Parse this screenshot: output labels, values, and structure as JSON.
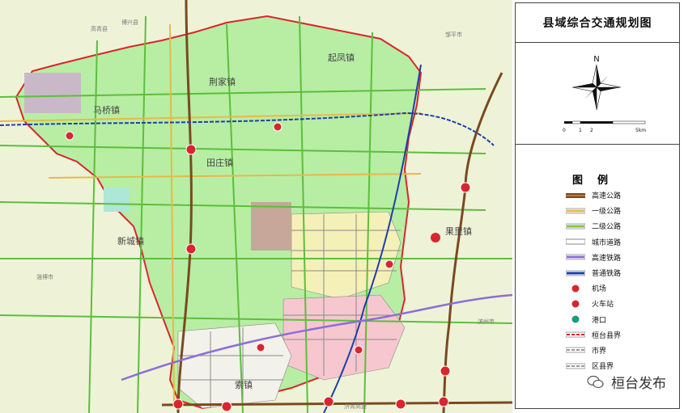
{
  "map": {
    "towns": [
      "马桥镇",
      "荆家镇",
      "起凤镇",
      "田庄镇",
      "新城镇",
      "索镇",
      "果里镇"
    ],
    "neighbors": [
      "高青县",
      "邹平市",
      "淄博市",
      "滨州市",
      "博兴县"
    ],
    "bottom_road": "济青高速"
  },
  "panel": {
    "title": "县域综合交通规划图",
    "north": "N",
    "scale": {
      "ticks": [
        "0",
        "1",
        "2",
        "5km"
      ]
    },
    "legend_title": "图例",
    "legend": [
      {
        "label": "高速公路",
        "kind": "expressway",
        "color": "#7a4a1e"
      },
      {
        "label": "一级公路",
        "kind": "solid",
        "color": "#e8b84a"
      },
      {
        "label": "二级公路",
        "kind": "solid",
        "color": "#7ec843"
      },
      {
        "label": "城市道路",
        "kind": "double",
        "color": "#8a8a8a"
      },
      {
        "label": "高速铁路",
        "kind": "solid",
        "color": "#8b6fd6"
      },
      {
        "label": "普通铁路",
        "kind": "solid",
        "color": "#1f3fa8"
      },
      {
        "label": "机场",
        "kind": "icon",
        "color": "#d9262e"
      },
      {
        "label": "火车站",
        "kind": "icon",
        "color": "#d9262e"
      },
      {
        "label": "港口",
        "kind": "icon",
        "color": "#1e9a7a"
      },
      {
        "label": "桓台县界",
        "kind": "dashed",
        "color": "#d9262e"
      },
      {
        "label": "市界",
        "kind": "dashed",
        "color": "#999999"
      },
      {
        "label": "区县界",
        "kind": "dashed",
        "color": "#999999"
      }
    ]
  },
  "watermark": {
    "text": "桓台发布"
  }
}
